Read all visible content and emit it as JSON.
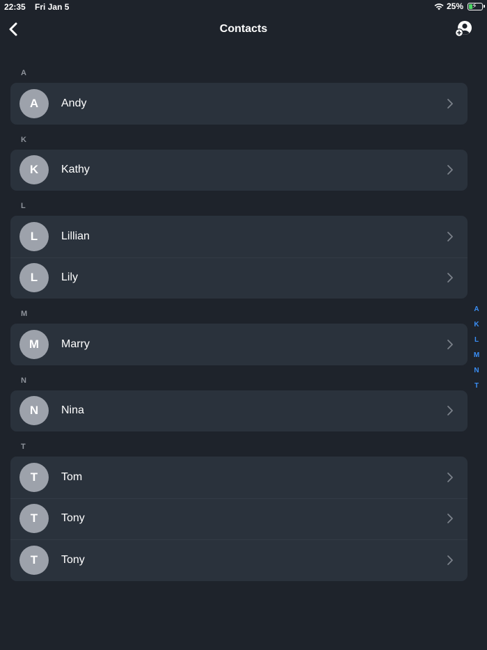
{
  "status_bar": {
    "time": "22:35",
    "date": "Fri Jan 5",
    "battery_text": "25%",
    "battery_level": 0.25,
    "icons": [
      "wifi-icon",
      "battery-icon",
      "charging-bolt-icon"
    ]
  },
  "nav": {
    "title": "Contacts",
    "back_icon": "chevron-left-icon",
    "add_icon": "add-contact-icon"
  },
  "sections": [
    {
      "letter": "A",
      "contacts": [
        {
          "initial": "A",
          "name": "Andy"
        }
      ]
    },
    {
      "letter": "K",
      "contacts": [
        {
          "initial": "K",
          "name": "Kathy"
        }
      ]
    },
    {
      "letter": "L",
      "contacts": [
        {
          "initial": "L",
          "name": "Lillian"
        },
        {
          "initial": "L",
          "name": "Lily"
        }
      ]
    },
    {
      "letter": "M",
      "contacts": [
        {
          "initial": "M",
          "name": "Marry"
        }
      ]
    },
    {
      "letter": "N",
      "contacts": [
        {
          "initial": "N",
          "name": "Nina"
        }
      ]
    },
    {
      "letter": "T",
      "contacts": [
        {
          "initial": "T",
          "name": "Tom"
        },
        {
          "initial": "T",
          "name": "Tony"
        },
        {
          "initial": "T",
          "name": "Tony"
        }
      ]
    }
  ],
  "index_bar": [
    "A",
    "K",
    "L",
    "M",
    "N",
    "T"
  ],
  "colors": {
    "background": "#1e232b",
    "card": "#2a323c",
    "avatar": "#9da2ab",
    "index_accent": "#3a8ef5",
    "battery_green": "#4cd964"
  }
}
